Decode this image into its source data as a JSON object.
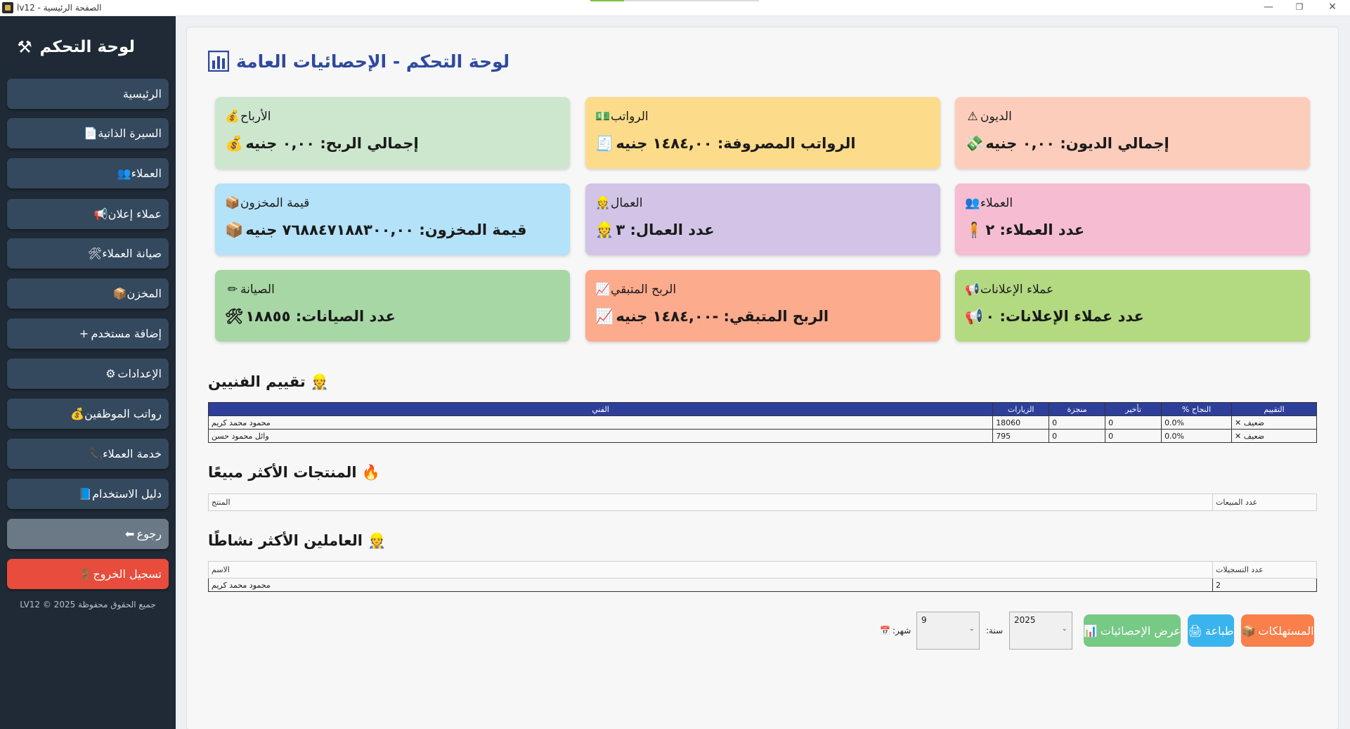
{
  "window": {
    "title": "الصفحة الرئيسية - lv12",
    "minimize": "—",
    "restore": "❐",
    "close": "✕"
  },
  "sidebar": {
    "title": "لوحة التحكم",
    "title_icon": "wrench-icon",
    "items": [
      {
        "label": "الرئيسية",
        "icon": ""
      },
      {
        "label": "السيرة الذاتية",
        "icon": "📄"
      },
      {
        "label": "العملاء",
        "icon": "👥"
      },
      {
        "label": "عملاء إعلان",
        "icon": "📢"
      },
      {
        "label": "صيانة العملاء",
        "icon": "🛠"
      },
      {
        "label": "المخزن",
        "icon": "📦"
      },
      {
        "label": "إضافة مستخدم",
        "icon": "+"
      },
      {
        "label": "الإعدادات",
        "icon": "⚙"
      },
      {
        "label": "رواتب الموظفين",
        "icon": "💰"
      },
      {
        "label": "خدمة العملاء",
        "icon": "📞"
      },
      {
        "label": "دليل الاستخدام",
        "icon": "📘"
      },
      {
        "label": "رجوع",
        "icon": "⬅"
      },
      {
        "label": "تسجيل الخروج",
        "icon": "🚪"
      }
    ],
    "copyright": "جميع الحقوق محفوظة LV12 © 2025"
  },
  "main": {
    "title": "لوحة التحكم - الإحصائيات العامة",
    "title_icon": "bar-chart-icon",
    "cards": [
      {
        "title": "الديون",
        "title_icon": "⚠",
        "value": "إجمالي الديون: ٠,٠٠ جنيه",
        "value_icon": "💸",
        "color": "#fdcdbb"
      },
      {
        "title": "الرواتب",
        "title_icon": "💵",
        "value": "الرواتب المصروفة: ١٤٨٤,٠٠ جنيه",
        "value_icon": "🧾",
        "color": "#fcdb8a"
      },
      {
        "title": "الأرباح",
        "title_icon": "💰",
        "value": "إجمالي الربح: ٠,٠٠ جنيه",
        "value_icon": "💰",
        "color": "#cde7cf"
      },
      {
        "title": "العملاء",
        "title_icon": "👥",
        "value": "عدد العملاء: ٢",
        "value_icon": "🧍",
        "color": "#f5bcd2"
      },
      {
        "title": "العمال",
        "title_icon": "👷",
        "value": "عدد العمال: ٣",
        "value_icon": "👷",
        "color": "#d1c4e6"
      },
      {
        "title": "قيمة المخزون",
        "title_icon": "📦",
        "value": "قيمة المخزون: ٧٦٨٨٤٧١٨٨٣٠٠,٠٠ جنيه",
        "value_icon": "📦",
        "color": "#b4e2f8"
      },
      {
        "title": "عملاء الإعلانات",
        "title_icon": "📢",
        "value": "عدد عملاء الإعلانات: ٠",
        "value_icon": "📢",
        "color": "#b3d981"
      },
      {
        "title": "الربح المتبقي",
        "title_icon": "📈",
        "value": "الربح المتبقي: -١٤٨٤,٠٠ جنيه",
        "value_icon": "📈",
        "color": "#fcab8d"
      },
      {
        "title": "الصيانة",
        "title_icon": "✏",
        "value": "عدد الصيانات: ١٨٨٥٥",
        "value_icon": "🛠",
        "color": "#a7d7a5"
      }
    ],
    "technicians": {
      "title": "تقييم الفنيين",
      "icon": "technician-icon",
      "columns": [
        "الفني",
        "الزيارات",
        "منجزة",
        "تأخير",
        "% النجاح",
        "التقييم"
      ],
      "rows": [
        {
          "name": "محمود محمد كريم",
          "visits": "18060",
          "done": "0",
          "delay": "0",
          "success": "0.0%",
          "rating": "ضعيف",
          "rating_icon": "✕"
        },
        {
          "name": "وائل محمود حسن",
          "visits": "795",
          "done": "0",
          "delay": "0",
          "success": "0.0%",
          "rating": "ضعيف",
          "rating_icon": "✕"
        }
      ]
    },
    "top_products": {
      "title": "المنتجات الأكثر مبيعًا",
      "icon": "flame-icon",
      "columns": [
        "المنتج",
        "عدد المبيعات"
      ]
    },
    "top_workers": {
      "title": "العاملين الأكثر نشاطًا",
      "icon": "worker-icon",
      "columns": [
        "الاسم",
        "عدد التسجيلات"
      ],
      "rows": [
        {
          "name": "محمود محمد كريم",
          "count": "2"
        }
      ]
    },
    "controls": {
      "month_label": ":شهر",
      "month_value": "9",
      "year_label": ":سنة",
      "year_value": "2025",
      "show_stats_label": "عرض الإحصائيات",
      "print_label": "طباعة",
      "consumables_label": "المستهلكات"
    }
  }
}
